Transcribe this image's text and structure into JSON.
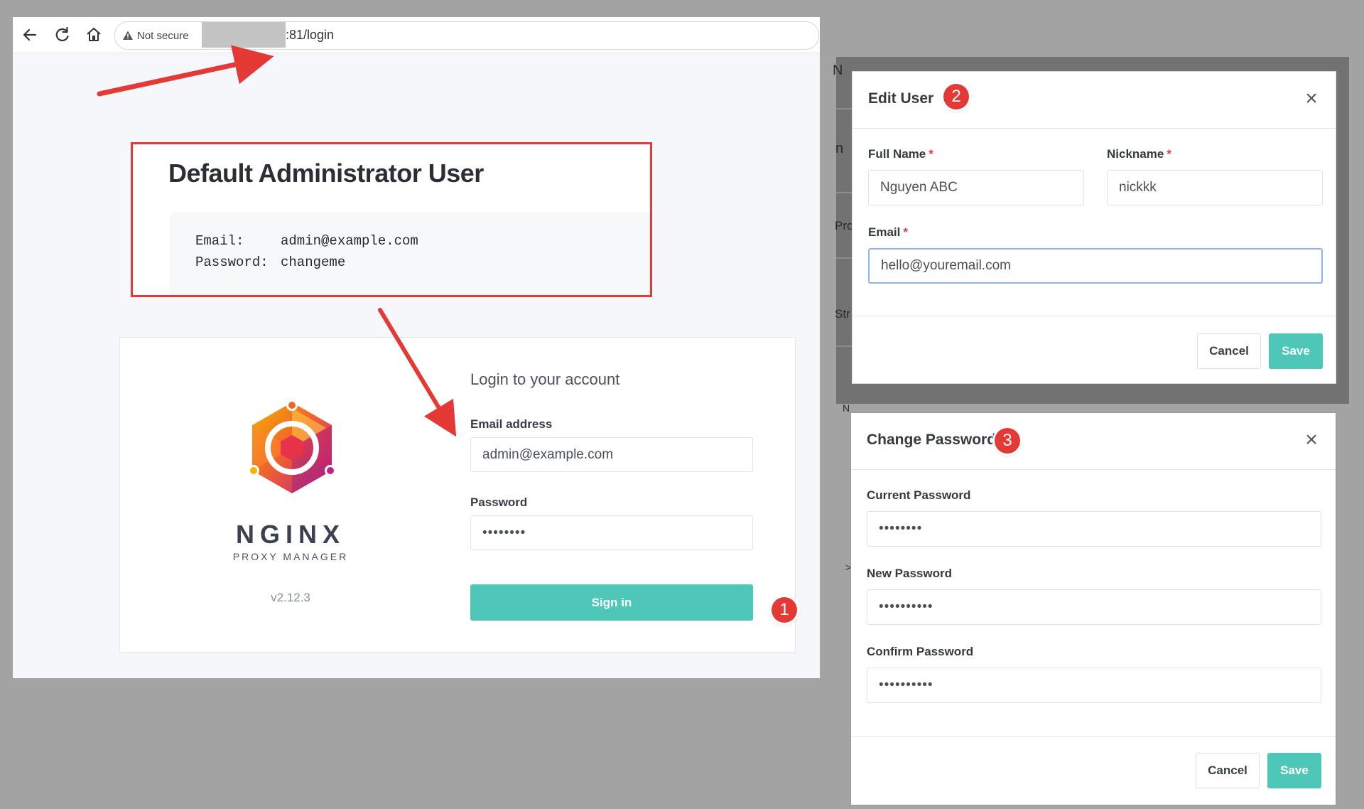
{
  "browser": {
    "security_label": "Not secure",
    "url": ":81/login"
  },
  "admin_note": {
    "title": "Default Administrator User",
    "email_key": "Email:",
    "email_value": "admin@example.com",
    "password_key": "Password:",
    "password_value": "changeme"
  },
  "login": {
    "brand_name": "NGINX",
    "brand_sub": "PROXY MANAGER",
    "version": "v2.12.3",
    "heading": "Login to your account",
    "email_label": "Email address",
    "email_value": "admin@example.com",
    "password_label": "Password",
    "password_value": "••••••••",
    "signin_label": "Sign in"
  },
  "background_ghost": {
    "line1": "N",
    "line2": "n",
    "line3": "Pro",
    "line4": "Str",
    "line5": ">"
  },
  "edit_user": {
    "title": "Edit User",
    "close_label": "×",
    "full_name_label": "Full Name",
    "full_name_value": "Nguyen ABC",
    "nickname_label": "Nickname",
    "nickname_value": "nickkk",
    "email_label": "Email",
    "email_value": "hello@youremail.com",
    "required_mark": "*",
    "cancel_label": "Cancel",
    "save_label": "Save"
  },
  "change_password": {
    "title": "Change Password",
    "close_label": "×",
    "current_label": "Current Password",
    "current_value": "••••••••",
    "new_label": "New Password",
    "new_value": "••••••••••",
    "confirm_label": "Confirm Password",
    "confirm_value": "••••••••••",
    "cancel_label": "Cancel",
    "save_label": "Save"
  },
  "callouts": {
    "one": "1",
    "two": "2",
    "three": "3"
  },
  "colors": {
    "accent": "#4fc7b8",
    "callout_red": "#e53935",
    "backdrop": "#a3a3a3"
  },
  "icons": [
    "back-arrow-icon",
    "reload-icon",
    "home-icon",
    "warning-icon",
    "nginx-logo-icon",
    "close-icon"
  ]
}
